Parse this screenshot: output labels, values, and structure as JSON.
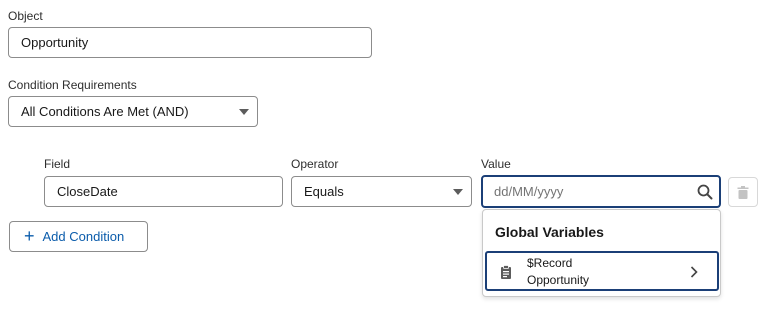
{
  "object": {
    "label": "Object",
    "value": "Opportunity"
  },
  "condition_requirements": {
    "label": "Condition Requirements",
    "value": "All Conditions Are Met (AND)"
  },
  "condition_row": {
    "field_label": "Field",
    "field_value": "CloseDate",
    "operator_label": "Operator",
    "operator_value": "Equals",
    "value_label": "Value",
    "value_placeholder": "dd/MM/yyyy"
  },
  "add_condition": {
    "icon": "plus-icon",
    "label": "Add Condition"
  },
  "dropdown": {
    "header": "Global Variables",
    "items": [
      {
        "icon": "clipboard-icon",
        "title": "$Record",
        "subtitle": "Opportunity"
      }
    ]
  },
  "colors": {
    "accent": "#0b5cab",
    "focus_border": "#1b3f77",
    "border": "#8c8c8c"
  }
}
